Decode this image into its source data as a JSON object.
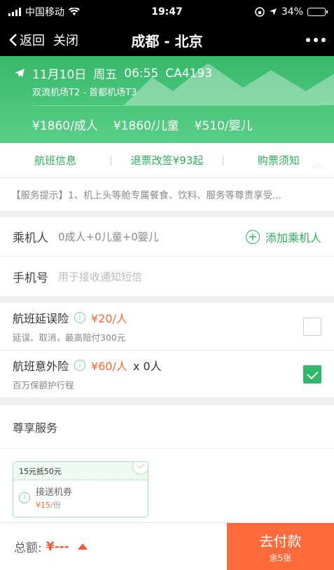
{
  "status_bar": {
    "carrier": "中国移动",
    "time": "19:47",
    "battery": "34%",
    "battery_level": 0.34
  },
  "nav": {
    "back_label": "返回",
    "close_label": "关闭",
    "title": "成都 - 北京"
  },
  "flight": {
    "date": "11月10日",
    "weekday": "周五",
    "time": "06:55",
    "flight_no": "CA4193",
    "airports": "双流机场T2 - 首都机场T3",
    "price_adult": "¥1860/成人",
    "price_child": "¥1860/儿童",
    "price_infant": "¥510/婴儿"
  },
  "tabs": [
    {
      "label": "航班信息"
    },
    {
      "label": "退票改签¥93起"
    },
    {
      "label": "购票须知"
    }
  ],
  "notice": "【服务提示】1、机上头等舱专属餐食、饮料、服务等尊贵享受...",
  "passenger": {
    "label": "乘机人",
    "value": "0成人+0儿童+0婴儿",
    "add_label": "添加乘机人"
  },
  "phone": {
    "label": "手机号",
    "placeholder": "用于接收通知短信"
  },
  "insurance": [
    {
      "name": "航班延误险",
      "price": "¥20/人",
      "qty": "",
      "desc": "延误、取消，最高赔付300元",
      "checked": false
    },
    {
      "name": "航班意外险",
      "price": "¥60/人",
      "qty": "x 0人",
      "desc": "百万保额护行程",
      "checked": true
    }
  ],
  "vip": {
    "title": "尊享服务",
    "coupon": {
      "tag": "15元抵50元",
      "name": "接送机券",
      "price": "¥15",
      "unit": "/份"
    }
  },
  "footer": {
    "total_label": "总额:",
    "amount": "¥---",
    "pay_label": "去付款",
    "pay_sub": "余5张"
  },
  "colors": {
    "brand_green": "#2eae5d",
    "accent_orange": "#ff6a3a"
  }
}
